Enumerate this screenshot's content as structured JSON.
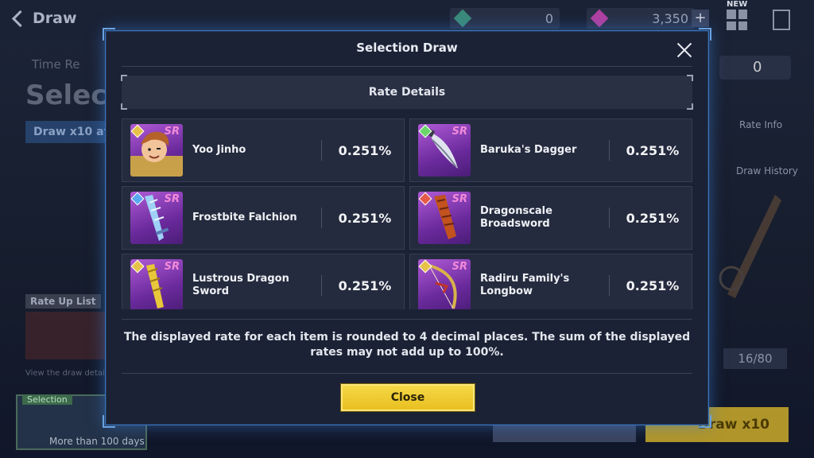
{
  "background": {
    "back_label": "Draw",
    "currency_1": "0",
    "currency_2": "3,350",
    "plus": "+",
    "new_tag": "NEW",
    "page_title": "Selection Draw",
    "time_label": "Time Re",
    "draw_banner": "Draw x10 at",
    "rate_up_list": "Rate Up List",
    "view_detail": "View the draw detail",
    "selection_tag": "Selection",
    "selection_days": "More than 100 days",
    "right_counter": "0",
    "rate_info": "Rate Info",
    "draw_history": "Draw History",
    "pity_count": "16/80",
    "draw_x10_button": "Draw x10"
  },
  "modal": {
    "title": "Selection Draw",
    "rate_header": "Rate Details",
    "items": [
      {
        "name": "Yoo Jinho",
        "rank": "SR",
        "rate": "0.251%",
        "element_color": "#e6c24a"
      },
      {
        "name": "Baruka's Dagger",
        "rank": "SR",
        "rate": "0.251%",
        "element_color": "#6ad66a"
      },
      {
        "name": "Frostbite Falchion",
        "rank": "SR",
        "rate": "0.251%",
        "element_color": "#5aa8f0"
      },
      {
        "name": "Dragonscale Broadsword",
        "rank": "SR",
        "rate": "0.251%",
        "element_color": "#e65a4a"
      },
      {
        "name": "Lustrous Dragon Sword",
        "rank": "SR",
        "rate": "0.251%",
        "element_color": "#e6c24a"
      },
      {
        "name": "Radiru Family's Longbow",
        "rank": "SR",
        "rate": "0.251%",
        "element_color": "#e6c24a"
      }
    ],
    "note": "The displayed rate for each item is rounded to 4 decimal places. The sum of the displayed rates may not add up to 100%.",
    "close_button": "Close"
  },
  "colors": {
    "accent_gold": "#f0cc2e",
    "modal_border": "#3b74b8",
    "sr_pink": "#f28ad8",
    "thumb_purple": "#8a3cc0"
  }
}
